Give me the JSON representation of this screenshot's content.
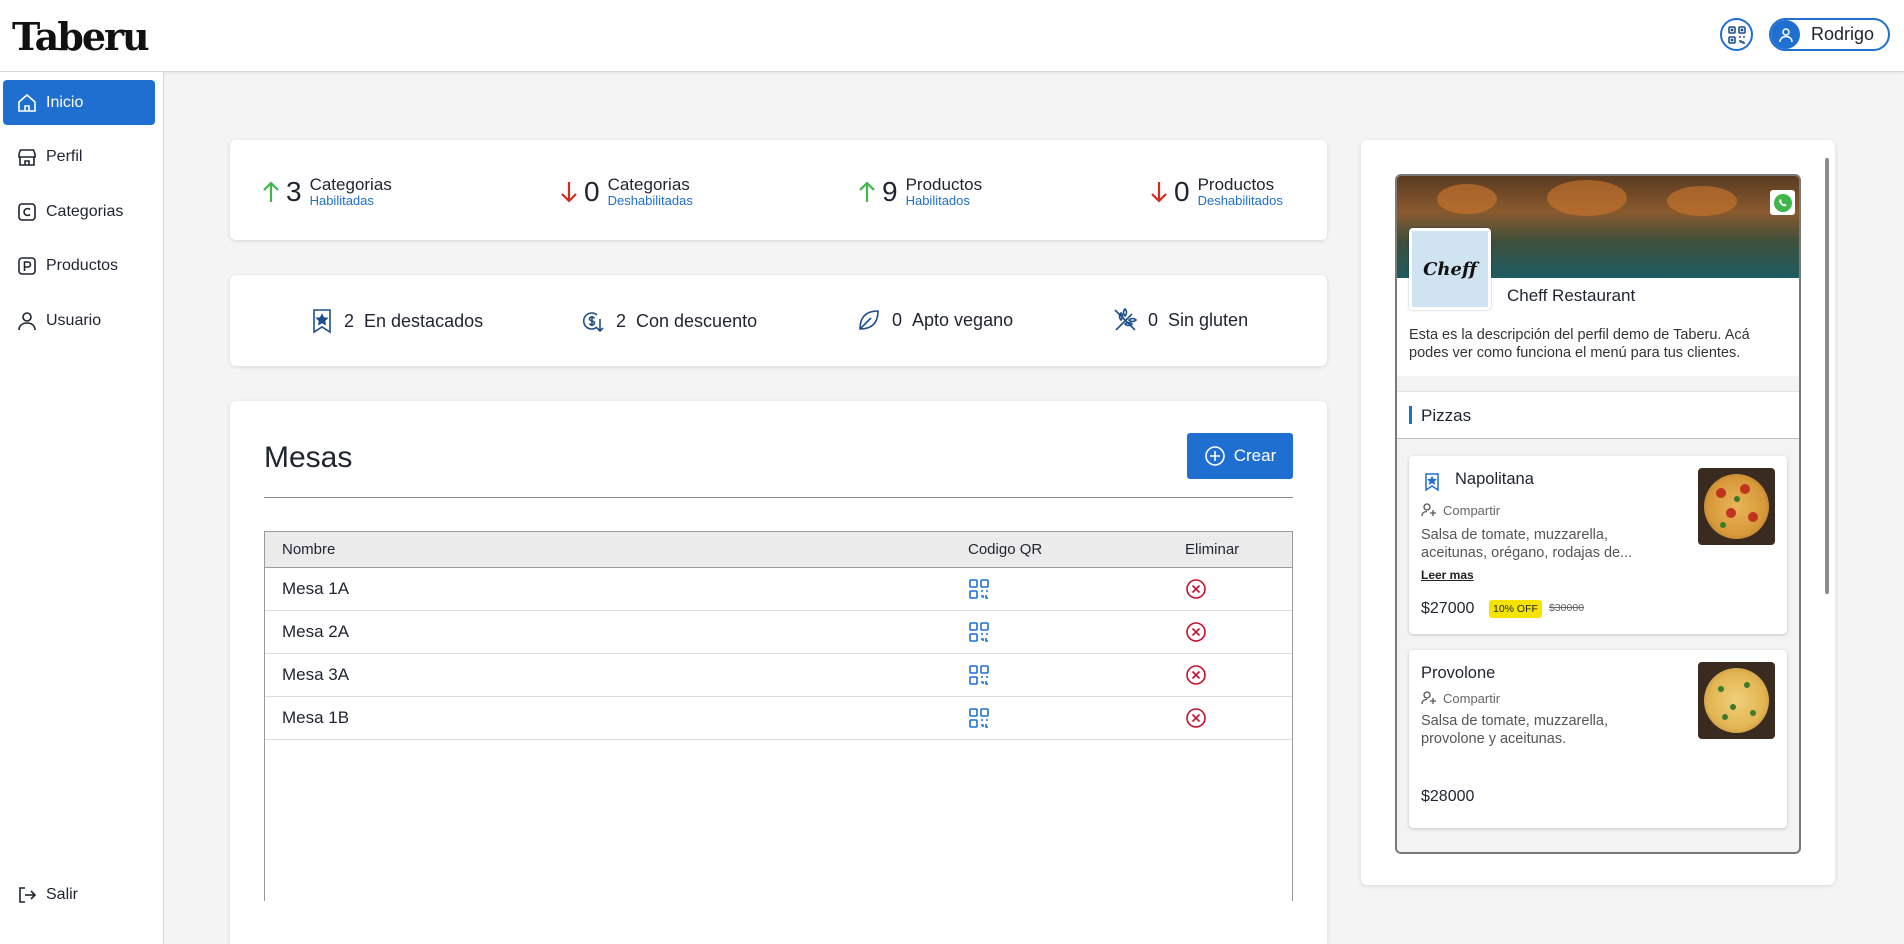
{
  "app": {
    "logo": "Taberu"
  },
  "header": {
    "user_name": "Rodrigo"
  },
  "sidebar": {
    "items": [
      {
        "label": "Inicio",
        "icon": "home-icon"
      },
      {
        "label": "Perfil",
        "icon": "store-icon"
      },
      {
        "label": "Categorias",
        "icon": "c-square-icon"
      },
      {
        "label": "Productos",
        "icon": "p-square-icon"
      },
      {
        "label": "Usuario",
        "icon": "user-icon"
      }
    ],
    "logout": "Salir"
  },
  "stats": [
    {
      "value": "3",
      "label": "Categorias",
      "sub": "Habilitadas",
      "direction": "up"
    },
    {
      "value": "0",
      "label": "Categorias",
      "sub": "Deshabilitadas",
      "direction": "down"
    },
    {
      "value": "9",
      "label": "Productos",
      "sub": "Habilitados",
      "direction": "up"
    },
    {
      "value": "0",
      "label": "Productos",
      "sub": "Deshabilitados",
      "direction": "down"
    }
  ],
  "features": [
    {
      "value": "2",
      "label": "En destacados",
      "icon": "bookmark-star-icon"
    },
    {
      "value": "2",
      "label": "Con descuento",
      "icon": "discount-icon"
    },
    {
      "value": "0",
      "label": "Apto vegano",
      "icon": "leaf-icon"
    },
    {
      "value": "0",
      "label": "Sin gluten",
      "icon": "wheat-icon"
    }
  ],
  "mesas": {
    "title": "Mesas",
    "create_label": "Crear",
    "columns": [
      "Nombre",
      "Codigo QR",
      "Eliminar"
    ],
    "rows": [
      {
        "name": "Mesa 1A"
      },
      {
        "name": "Mesa 2A"
      },
      {
        "name": "Mesa 3A"
      },
      {
        "name": "Mesa 1B"
      }
    ]
  },
  "preview": {
    "restaurant_name": "Cheff Restaurant",
    "avatar_text": "Cheff",
    "description": "Esta es la descripción del perfil demo de Taberu. Acá podes ver como funciona el menú para tus clientes.",
    "category": "Pizzas",
    "products": [
      {
        "name": "Napolitana",
        "share": "Compartir",
        "description": "Salsa de tomate, muzzarella, aceitunas, orégano, rodajas de...",
        "more": "Leer mas",
        "price": "$27000",
        "discount": "10% OFF",
        "old_price": "$30000"
      },
      {
        "name": "Provolone",
        "share": "Compartir",
        "description": "Salsa de tomate, muzzarella, provolone y aceitunas.",
        "price": "$28000"
      }
    ]
  },
  "colors": {
    "primary": "#1f6fd1",
    "up": "#3fb54a",
    "down": "#d32a1f",
    "danger": "#c8102e"
  }
}
